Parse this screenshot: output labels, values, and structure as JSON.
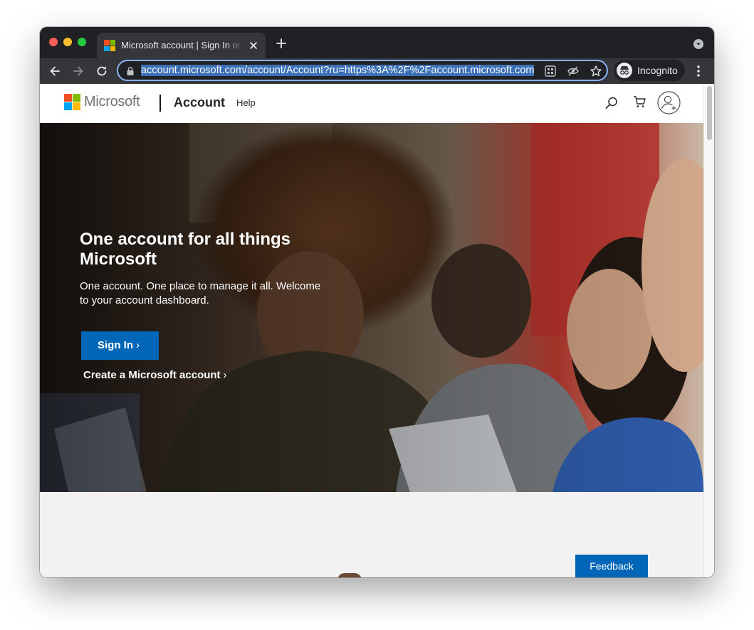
{
  "browser": {
    "tab": {
      "title": "Microsoft account | Sign In or Create"
    },
    "address_bar": {
      "url": "account.microsoft.com/account/Account?ru=https%3A%2F%2Faccount.microsoft.com"
    },
    "profile": {
      "label": "Incognito"
    },
    "icons": [
      "back-icon",
      "forward-icon",
      "reload-icon",
      "lock-icon",
      "qr-code-icon",
      "eye-off-icon",
      "star-icon",
      "incognito-icon",
      "more-vert-icon",
      "new-tab-icon",
      "close-icon"
    ]
  },
  "site_header": {
    "brand": "Microsoft",
    "section": "Account",
    "help_link": "Help",
    "icons": [
      "search-icon",
      "cart-icon",
      "account-icon"
    ]
  },
  "hero": {
    "title": "One account for all things Microsoft",
    "subtitle": "One account. One place to manage it all. Welcome to your account dashboard.",
    "sign_in_label": "Sign In",
    "create_account_label": "Create a Microsoft account"
  },
  "feedback": {
    "label": "Feedback"
  },
  "colors": {
    "accent": "#0067b8",
    "omnibox_focus": "#8ab4f8",
    "tabstrip_bg": "#202124",
    "toolbar_bg": "#35363a",
    "logo_red": "#f25022",
    "logo_green": "#7fba00",
    "logo_blue": "#00a4ef",
    "logo_yellow": "#ffb900"
  }
}
